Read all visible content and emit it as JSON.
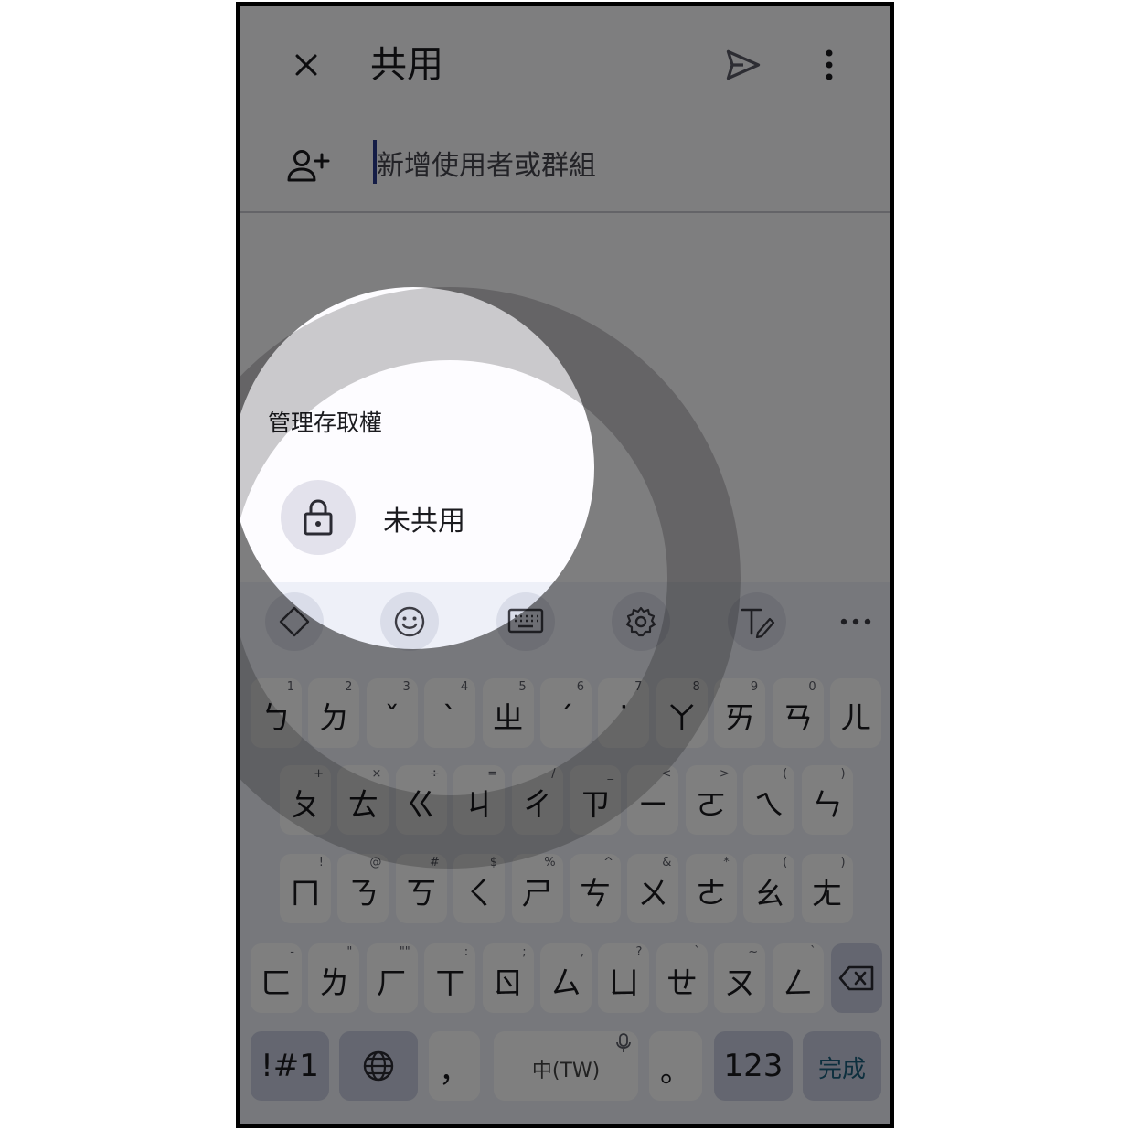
{
  "appbar": {
    "title": "共用",
    "close_icon": "close-icon",
    "send_icon": "send-icon",
    "more_icon": "more-vert-icon"
  },
  "add_people": {
    "icon": "person-add-icon",
    "placeholder": "新增使用者或群組",
    "value": ""
  },
  "manage_access": {
    "title": "管理存取權",
    "item": {
      "icon": "lock-icon",
      "label": "未共用"
    }
  },
  "keyboard": {
    "toolbar": [
      "resize-icon",
      "emoji-icon",
      "keyboard-icon",
      "settings-icon",
      "handwriting-icon",
      "more-horiz-icon"
    ],
    "row1": [
      {
        "main": "ㄅ",
        "hint": "1"
      },
      {
        "main": "ㄉ",
        "hint": "2"
      },
      {
        "main": "ˇ",
        "hint": "3"
      },
      {
        "main": "ˋ",
        "hint": "4"
      },
      {
        "main": "ㄓ",
        "hint": "5"
      },
      {
        "main": "ˊ",
        "hint": "6"
      },
      {
        "main": "˙",
        "hint": "7"
      },
      {
        "main": "ㄚ",
        "hint": "8"
      },
      {
        "main": "ㄞ",
        "hint": "9"
      },
      {
        "main": "ㄢ",
        "hint": "0"
      },
      {
        "main": "ㄦ",
        "hint": ""
      }
    ],
    "row2": [
      {
        "main": "ㄆ",
        "hint": "+"
      },
      {
        "main": "ㄊ",
        "hint": "×"
      },
      {
        "main": "ㄍ",
        "hint": "÷"
      },
      {
        "main": "ㄐ",
        "hint": "="
      },
      {
        "main": "ㄔ",
        "hint": "/"
      },
      {
        "main": "ㄗ",
        "hint": "_"
      },
      {
        "main": "ㄧ",
        "hint": "<"
      },
      {
        "main": "ㄛ",
        "hint": ">"
      },
      {
        "main": "ㄟ",
        "hint": "("
      },
      {
        "main": "ㄣ",
        "hint": ")"
      }
    ],
    "row3": [
      {
        "main": "ㄇ",
        "hint": "!"
      },
      {
        "main": "ㄋ",
        "hint": "@"
      },
      {
        "main": "ㄎ",
        "hint": "#"
      },
      {
        "main": "ㄑ",
        "hint": "$"
      },
      {
        "main": "ㄕ",
        "hint": "%"
      },
      {
        "main": "ㄘ",
        "hint": "^"
      },
      {
        "main": "ㄨ",
        "hint": "&"
      },
      {
        "main": "ㄜ",
        "hint": "*"
      },
      {
        "main": "ㄠ",
        "hint": "("
      },
      {
        "main": "ㄤ",
        "hint": ")"
      }
    ],
    "row4": [
      {
        "main": "ㄈ",
        "hint": "-"
      },
      {
        "main": "ㄌ",
        "hint": "\""
      },
      {
        "main": "ㄏ",
        "hint": "\"\""
      },
      {
        "main": "ㄒ",
        "hint": ":"
      },
      {
        "main": "ㄖ",
        "hint": ";"
      },
      {
        "main": "ㄙ",
        "hint": ","
      },
      {
        "main": "ㄩ",
        "hint": "?"
      },
      {
        "main": "ㄝ",
        "hint": "`"
      },
      {
        "main": "ㄡ",
        "hint": "~"
      },
      {
        "main": "ㄥ",
        "hint": "`"
      }
    ],
    "backspace_icon": "backspace-icon",
    "bottom": {
      "symbols": "!#1",
      "globe_icon": "globe-icon",
      "comma": "，",
      "space": "中(TW)",
      "mic_icon": "mic-icon",
      "period": "。",
      "numbers": "123",
      "done": "完成"
    }
  },
  "colors": {
    "keyboard_bg": "#eef0f8",
    "key_bg": "#ffffff",
    "func_key_bg": "#c9cde0",
    "caret": "#2a3a8c",
    "overlay": "rgba(0,0,0,0.5)"
  }
}
